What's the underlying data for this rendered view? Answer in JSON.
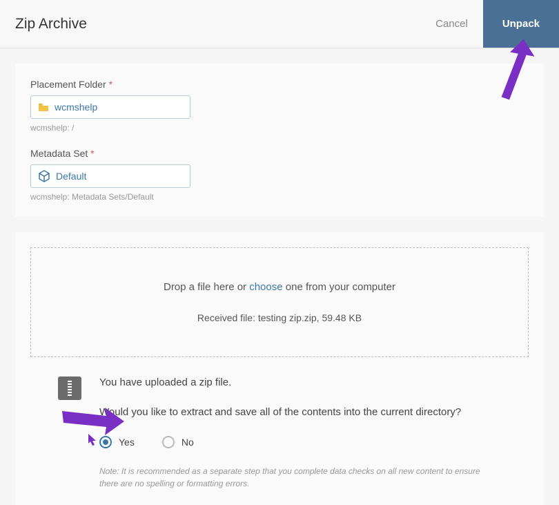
{
  "header": {
    "title": "Zip Archive",
    "cancel": "Cancel",
    "unpack": "Unpack"
  },
  "placement": {
    "label": "Placement Folder",
    "value": "wcmshelp",
    "hint": "wcmshelp: /"
  },
  "metadata": {
    "label": "Metadata Set",
    "value": "Default",
    "hint": "wcmshelp: Metadata Sets/Default"
  },
  "dropzone": {
    "prefix": "Drop a file here or ",
    "choose": "choose",
    "suffix": " one from your computer",
    "received": "Received file: testing zip.zip, 59.48 KB"
  },
  "extract": {
    "uploaded": "You have uploaded a zip file.",
    "question": "Would you like to extract and save all of the contents into the current directory?",
    "yes": "Yes",
    "no": "No",
    "note": "Note: It is recommended as a separate step that you complete data checks on all new content to ensure there are no spelling or formatting errors."
  },
  "required_mark": " *"
}
